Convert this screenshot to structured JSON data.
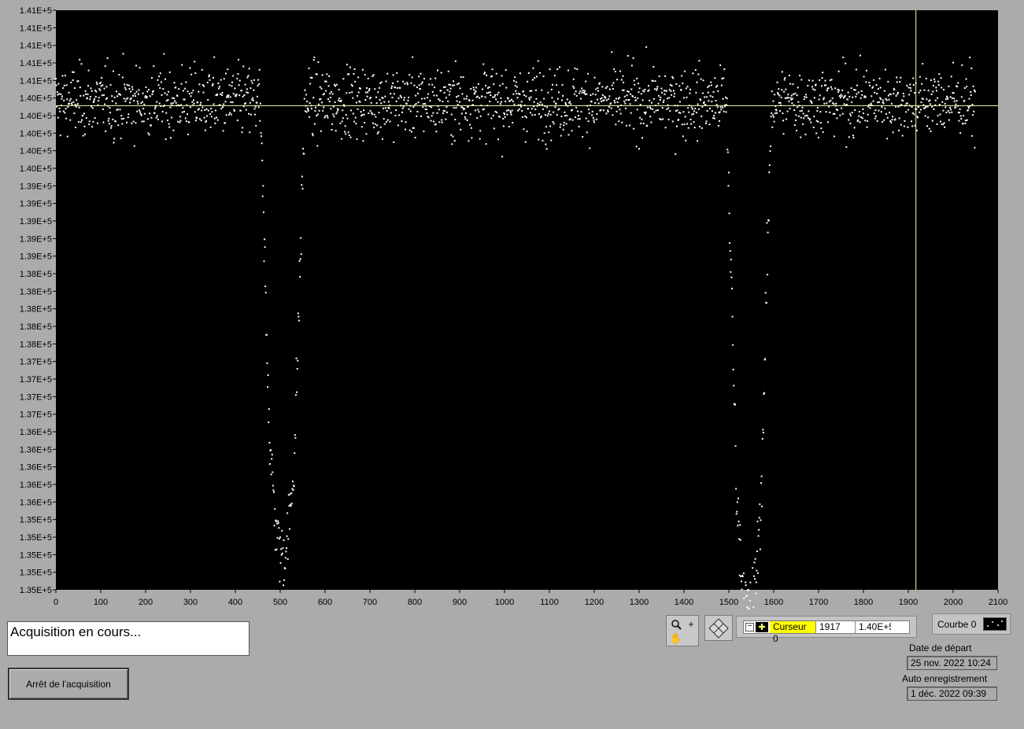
{
  "graph": {
    "background": "#000000",
    "plot_color": "#ffffff",
    "cursor_color": "#ffff99",
    "cursor_x": 1917,
    "cursor_y": 140009
  },
  "chart_data": {
    "type": "scatter",
    "xlim": [
      0,
      2100
    ],
    "ylim": [
      134980,
      141000
    ],
    "x_ticks": [
      "0",
      "100",
      "200",
      "300",
      "400",
      "500",
      "600",
      "700",
      "800",
      "900",
      "1000",
      "1100",
      "1200",
      "1300",
      "1400",
      "1500",
      "1600",
      "1700",
      "1800",
      "1900",
      "2000",
      "2100"
    ],
    "y_tick_labels": [
      "1.41E+5",
      "1.41E+5",
      "1.41E+5",
      "1.41E+5",
      "1.41E+5",
      "1.40E+5",
      "1.40E+5",
      "1.40E+5",
      "1.40E+5",
      "1.40E+5",
      "1.39E+5",
      "1.39E+5",
      "1.39E+5",
      "1.39E+5",
      "1.39E+5",
      "1.38E+5",
      "1.38E+5",
      "1.38E+5",
      "1.38E+5",
      "1.38E+5",
      "1.37E+5",
      "1.37E+5",
      "1.37E+5",
      "1.37E+5",
      "1.36E+5",
      "1.36E+5",
      "1.36E+5",
      "1.36E+5",
      "1.36E+5",
      "1.35E+5",
      "1.35E+5",
      "1.35E+5",
      "1.35E+5",
      "1.35E+5"
    ],
    "series": [
      {
        "baseline": 140050,
        "noise": 180,
        "n_points": 2050,
        "transits": [
          {
            "center": 505,
            "half_width": 28,
            "ingress": 22,
            "depth": 4700
          },
          {
            "center": 1545,
            "half_width": 28,
            "ingress": 22,
            "depth": 5300
          }
        ]
      }
    ]
  },
  "status": {
    "message": "Acquisition en cours..."
  },
  "stop_button": {
    "label": "Arrêt de l'acquisition"
  },
  "cursor_legend": {
    "name": "Curseur 0",
    "x": "1917",
    "y": "1.40E+5"
  },
  "plot_legend": {
    "name": "Courbe 0"
  },
  "start_date": {
    "label": "Date de départ",
    "value": "25 nov. 2022 10:24"
  },
  "auto_save": {
    "label": "Auto enregistrement",
    "value": "1 déc. 2022 09:39"
  }
}
